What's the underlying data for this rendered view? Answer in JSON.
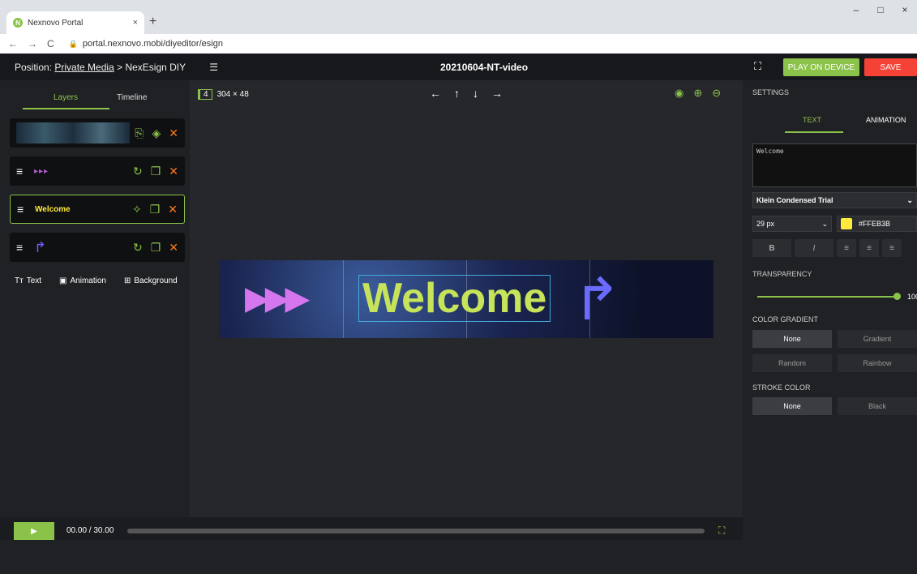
{
  "browser": {
    "tab_title": "Nexnovo Portal",
    "tab_close": "×",
    "new_tab": "+",
    "favicon_letter": "N",
    "url": "portal.nexnovo.mobi/diyeditor/esign",
    "nav_back": "←",
    "nav_forward": "→",
    "nav_reload": "C",
    "win_minimize": "–",
    "win_maximize": "□",
    "win_close": "×"
  },
  "topbar": {
    "position_label": "Position:",
    "breadcrumb_link": "Private Media",
    "breadcrumb_sep": ">",
    "breadcrumb_current": "NexEsign DIY",
    "video_title": "20210604-NT-video",
    "play_on_device": "PLAY ON DEVICE",
    "save": "SAVE"
  },
  "left_panel": {
    "tab_layers": "Layers",
    "tab_timeline": "Timeline",
    "layers": [
      {
        "type": "background",
        "label": ""
      },
      {
        "type": "animation",
        "label": "▸▸▸"
      },
      {
        "type": "text",
        "label": "Welcome"
      },
      {
        "type": "image",
        "label": "↱"
      }
    ],
    "add_text": "Text",
    "add_animation": "Animation",
    "add_background": "Background"
  },
  "canvas": {
    "layer_count": "4",
    "dimensions": "304 × 48",
    "text": "Welcome"
  },
  "playback": {
    "play": "▶",
    "time": "00.00  /  30.00"
  },
  "settings": {
    "header": "SETTINGS",
    "tab_text": "TEXT",
    "tab_animation": "ANIMATION",
    "text_value": "Welcome",
    "font": "Klein Condensed Trial",
    "font_size": "29 px",
    "color_hex": "#FFEB3B",
    "format_bold": "B",
    "format_italic": "I",
    "transparency_label": "TRANSPARENCY",
    "transparency_value": "100",
    "color_gradient_label": "COLOR GRADIENT",
    "gradient_options": [
      "None",
      "Gradient",
      "Random",
      "Rainbow"
    ],
    "stroke_color_label": "STROKE COLOR",
    "stroke_options": [
      "None",
      "Black"
    ]
  },
  "colors": {
    "accent": "#8bc34a",
    "danger": "#f44336",
    "text_color": "#ffeb3b"
  }
}
